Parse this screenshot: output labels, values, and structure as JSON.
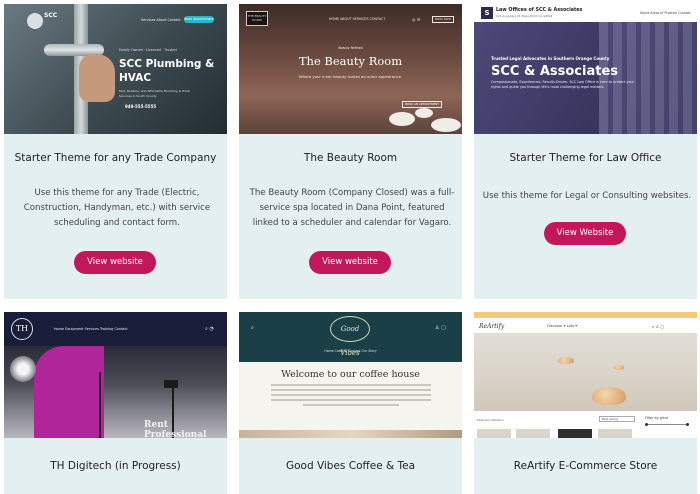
{
  "cards": [
    {
      "title": "Starter Theme for any Trade Company",
      "description": "Use this theme for any Trade (Electric, Construction, Handyman, etc.) with service scheduling and contact form.",
      "button": "View website",
      "preview": {
        "brand": "SCC",
        "nav": "Services   About   Contact",
        "cta": "Book Appointment",
        "kicker": "Family Owned · Licensed · Trusted",
        "headline": "SCC Plumbing & HVAC",
        "sub": "Fast, Reliable, and Affordable Plumbing & HVAC Services in South County",
        "phone": "949-555-5555"
      }
    },
    {
      "title": "The Beauty Room",
      "description": "The Beauty Room (Company Closed) was a full-service spa located in Dana Point, featured linked to a scheduler and calendar for Vagaro.",
      "button": "View website",
      "preview": {
        "logo": "THE BEAUTY ROOM",
        "nav": "HOME   ABOUT   SERVICES   CONTACT",
        "book": "BOOK NOW",
        "small": "Beauty Refined",
        "headline": "The Beauty Room",
        "sub": "Where your inner beauty makes an outer appearance.",
        "appointment": "BOOK AN APPOINTMENT"
      }
    },
    {
      "title": "Starter Theme for Law Office",
      "description": "Use this theme for Legal or Consulting websites.",
      "button": "View Website",
      "preview": {
        "firm": "Law Offices of SCC & Associates",
        "address": "123 Anywhere St, Dana Point, CA 92629",
        "nav": "Home   Areas of Practice   Contact",
        "kicker": "Trusted Legal Advocates in Southern Orange County",
        "headline": "SCC & Associates",
        "sub": "Compassionate, Experienced, Results-Driven. SCC Law Office is here to protect your rights and guide you through life's most challenging legal matters."
      }
    },
    {
      "title": "TH Digitech (in Progress)",
      "preview": {
        "logo": "TH",
        "nav": "Home   Equipment   Services   Training   Contact",
        "headline": "Rent Professional"
      }
    },
    {
      "title": "Good Vibes Coffee & Tea",
      "preview": {
        "logo": "Good Vibes",
        "menu": "Home   Catalog   Contact   Our Story",
        "headline": "Welcome to our coffee house"
      }
    },
    {
      "title": "ReArtify E-Commerce Store",
      "preview": {
        "logo": "ReArtify",
        "nav": "Discover ▾   Lots ▾",
        "label": "Featured collection",
        "sort": "Best selling",
        "filter": "Filter by price"
      }
    }
  ],
  "colors": {
    "card_bg": "#e4eff2",
    "button_bg": "#c2185b",
    "button_text": "#ffffff"
  }
}
